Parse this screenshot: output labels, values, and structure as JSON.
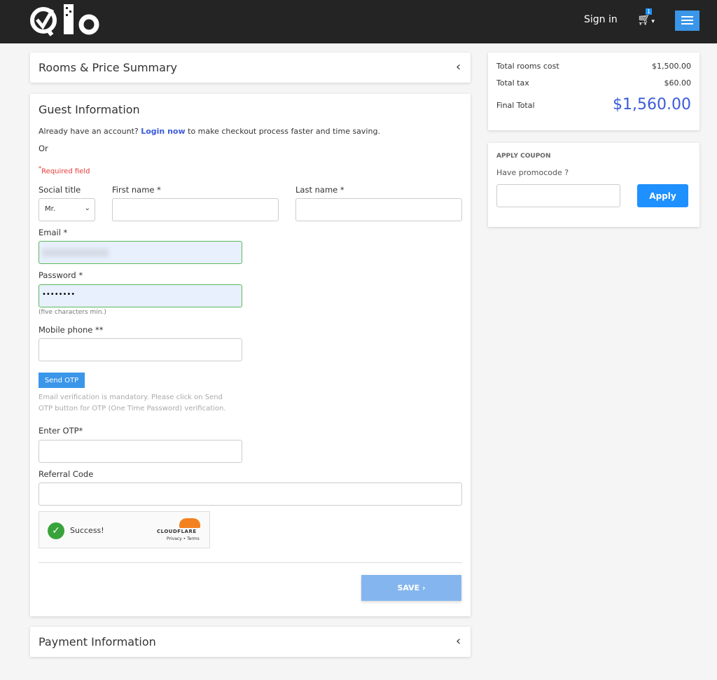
{
  "header": {
    "logo": "Qlo",
    "sign_in": "Sign in",
    "cart_count": "1"
  },
  "rooms_section": {
    "title": "Rooms & Price Summary"
  },
  "guest": {
    "title": "Guest Information",
    "account_prompt": "Already have an account?",
    "login_link": "Login now",
    "account_suffix": "to make checkout process faster and time saving.",
    "or": "Or",
    "required": "Required field",
    "social_title_label": "Social title",
    "social_title_value": "Mr.",
    "first_name_label": "First name *",
    "last_name_label": "Last name *",
    "email_label": "Email *",
    "password_label": "Password *",
    "password_value": "••••••••",
    "password_hint": "(five characters min.)",
    "mobile_label": "Mobile phone **",
    "send_otp": "Send OTP",
    "otp_hint": "Email verification is mandatory. Please click on Send OTP button for OTP (One Time Password) verification.",
    "otp_label": "Enter OTP*",
    "referral_label": "Referral Code",
    "captcha_status": "Success!",
    "captcha_brand": "CLOUDFLARE",
    "captcha_links": "Privacy • Terms",
    "save": "SAVE"
  },
  "payment_section": {
    "title": "Payment Information"
  },
  "summary": {
    "rooms_cost_label": "Total rooms cost",
    "rooms_cost": "$1,500.00",
    "tax_label": "Total tax",
    "tax": "$60.00",
    "final_label": "Final Total",
    "final": "$1,560.00"
  },
  "coupon": {
    "title": "APPLY COUPON",
    "prompt": "Have promocode ?",
    "apply": "Apply"
  },
  "colors": {
    "accent": "#1e90ff",
    "link": "#3b5bdb",
    "required": "#e53935",
    "nav": "#242424"
  }
}
